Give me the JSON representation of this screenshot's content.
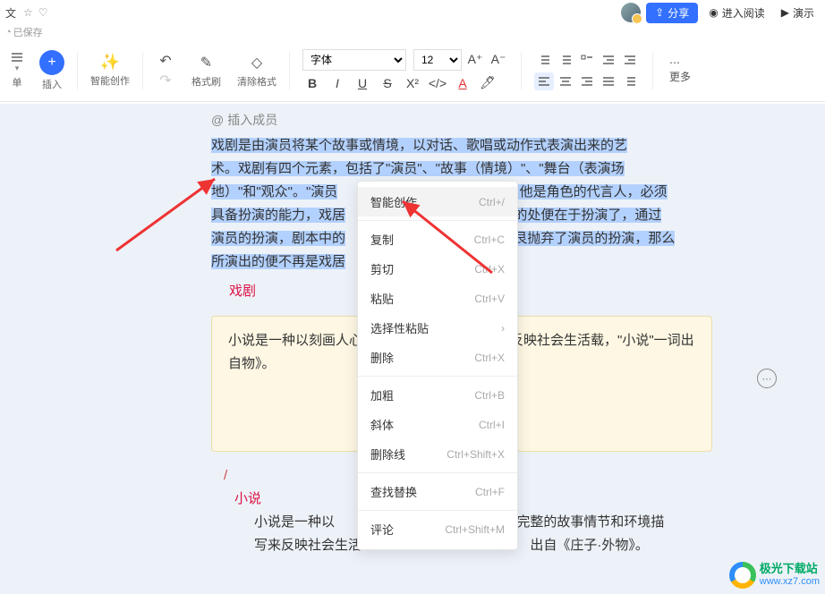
{
  "topbar": {
    "title_suffix": "文",
    "saved": "已保存",
    "share": "分享",
    "read_mode": "进入阅读",
    "present": "演示"
  },
  "toolbar": {
    "menu": "单",
    "insert": "插入",
    "ai": "智能创作",
    "format_painter": "格式刷",
    "clear_format": "清除格式",
    "font_label": "字体",
    "font_size": "12",
    "more": "更多"
  },
  "content": {
    "insert_member": "插入成员",
    "p1a": "戏剧是由演员将某个故事或情境，以对话、歌唱或动作式表演出来的艺",
    "p1b": "术。戏剧有四个元素，包括了\"演员\"、\"故事（情境）\"、\"舞台（表演场",
    "p1c_pre": "地）\"和\"观众\"。\"演员",
    "p1c_post": "，他是角色的代言人，必须",
    "p1d_pre": "具备扮演的能力，戏居",
    "p1d_post": "的处便在于扮演了，通过",
    "p1e_pre": "演员的扮演，剧本中的",
    "p1e_post": "艮抛弃了演员的扮演，那么",
    "p1f_pre": "所演出的便不再是戏居",
    "heading1": "戏剧",
    "card": "小说是一种以刻画人心、通过完整的故事描写来反映社会生活载，\"小说\"一词出自物》。",
    "slash": "/",
    "heading2": "小说",
    "p2a": "小说是一种以",
    "p2a_post": "过完整的故事情节和环境描",
    "p2b": "写来反映社会生活",
    "p2b_post": "出自《庄子·外物》。"
  },
  "menu": {
    "ai": {
      "label": "智能创作",
      "sc": "Ctrl+/"
    },
    "copy": {
      "label": "复制",
      "sc": "Ctrl+C"
    },
    "cut": {
      "label": "剪切",
      "sc": "Ctrl+X"
    },
    "paste": {
      "label": "粘贴",
      "sc": "Ctrl+V"
    },
    "paste_special": {
      "label": "选择性粘贴",
      "sc": "›"
    },
    "delete": {
      "label": "删除",
      "sc": "Ctrl+X"
    },
    "bold": {
      "label": "加粗",
      "sc": "Ctrl+B"
    },
    "italic": {
      "label": "斜体",
      "sc": "Ctrl+I"
    },
    "strike": {
      "label": "删除线",
      "sc": "Ctrl+Shift+X"
    },
    "find": {
      "label": "查找替换",
      "sc": "Ctrl+F"
    },
    "comment": {
      "label": "评论",
      "sc": "Ctrl+Shift+M"
    }
  },
  "watermark": {
    "name": "极光下载站",
    "url": "www.xz7.com"
  }
}
